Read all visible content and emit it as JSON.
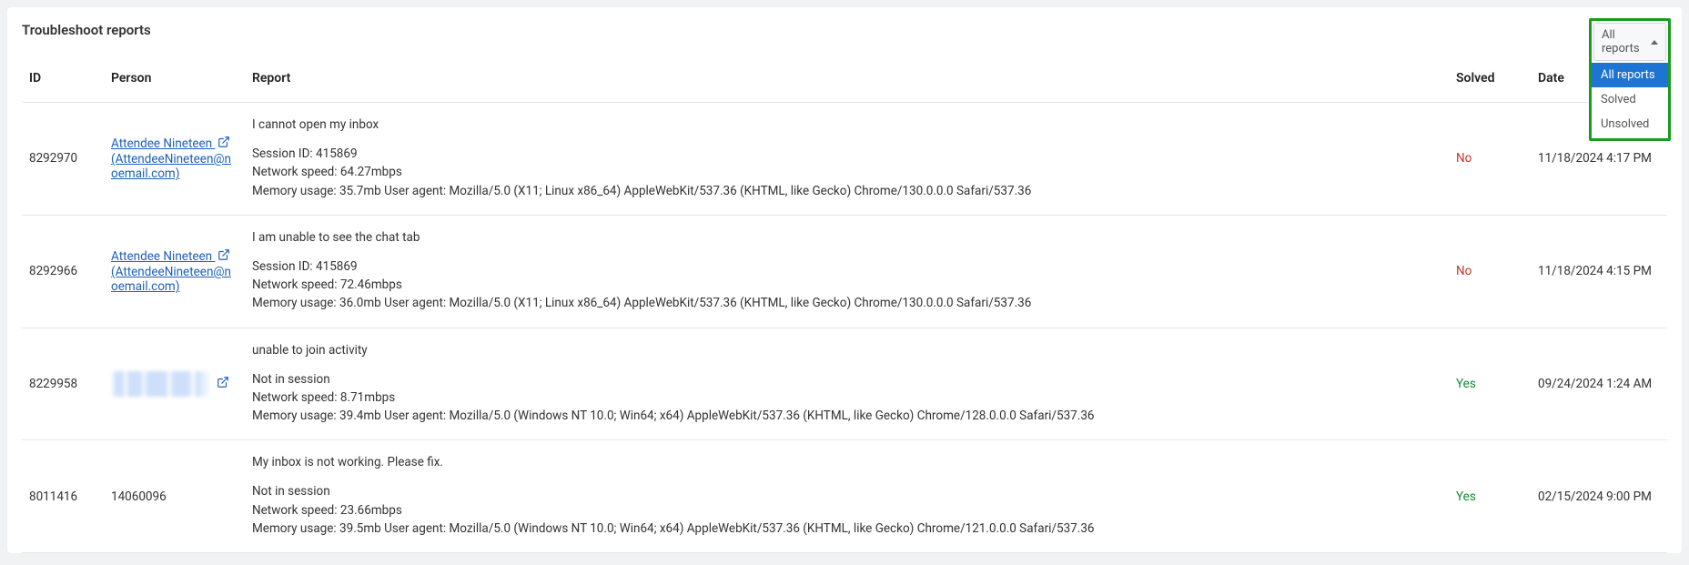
{
  "title": "Troubleshoot reports",
  "filter": {
    "selected": "All reports",
    "options": [
      "All reports",
      "Solved",
      "Unsolved"
    ]
  },
  "columns": {
    "id": "ID",
    "person": "Person",
    "report": "Report",
    "solved": "Solved",
    "date": "Date"
  },
  "rows": [
    {
      "id": "8292970",
      "person_name": "Attendee Nineteen",
      "person_email": "(AttendeeNineteen@noemail.com)",
      "person_redacted": false,
      "report_title": "I cannot open my inbox",
      "session": "Session ID: 415869",
      "network": "Network speed: 64.27mbps",
      "memory": "Memory usage: 35.7mb User agent: Mozilla/5.0 (X11; Linux x86_64) AppleWebKit/537.36 (KHTML, like Gecko) Chrome/130.0.0.0 Safari/537.36",
      "solved": "No",
      "solved_class": "solved-no",
      "date": "11/18/2024 4:17 PM"
    },
    {
      "id": "8292966",
      "person_name": "Attendee Nineteen",
      "person_email": "(AttendeeNineteen@noemail.com)",
      "person_redacted": false,
      "report_title": "I am unable to see the chat tab",
      "session": "Session ID: 415869",
      "network": "Network speed: 72.46mbps",
      "memory": "Memory usage: 36.0mb User agent: Mozilla/5.0 (X11; Linux x86_64) AppleWebKit/537.36 (KHTML, like Gecko) Chrome/130.0.0.0 Safari/537.36",
      "solved": "No",
      "solved_class": "solved-no",
      "date": "11/18/2024 4:15 PM"
    },
    {
      "id": "8229958",
      "person_name": "",
      "person_email": "",
      "person_redacted": true,
      "report_title": "unable to join activity",
      "session": "Not in session",
      "network": "Network speed: 8.71mbps",
      "memory": "Memory usage: 39.4mb User agent: Mozilla/5.0 (Windows NT 10.0; Win64; x64) AppleWebKit/537.36 (KHTML, like Gecko) Chrome/128.0.0.0 Safari/537.36",
      "solved": "Yes",
      "solved_class": "solved-yes",
      "date": "09/24/2024 1:24 AM"
    },
    {
      "id": "8011416",
      "person_name": "14060096",
      "person_email": "",
      "person_redacted": false,
      "person_plain": true,
      "report_title": "My inbox is not working. Please fix.",
      "session": "Not in session",
      "network": "Network speed: 23.66mbps",
      "memory": "Memory usage: 39.5mb User agent: Mozilla/5.0 (Windows NT 10.0; Win64; x64) AppleWebKit/537.36 (KHTML, like Gecko) Chrome/121.0.0.0 Safari/537.36",
      "solved": "Yes",
      "solved_class": "solved-yes",
      "date": "02/15/2024 9:00 PM"
    }
  ]
}
